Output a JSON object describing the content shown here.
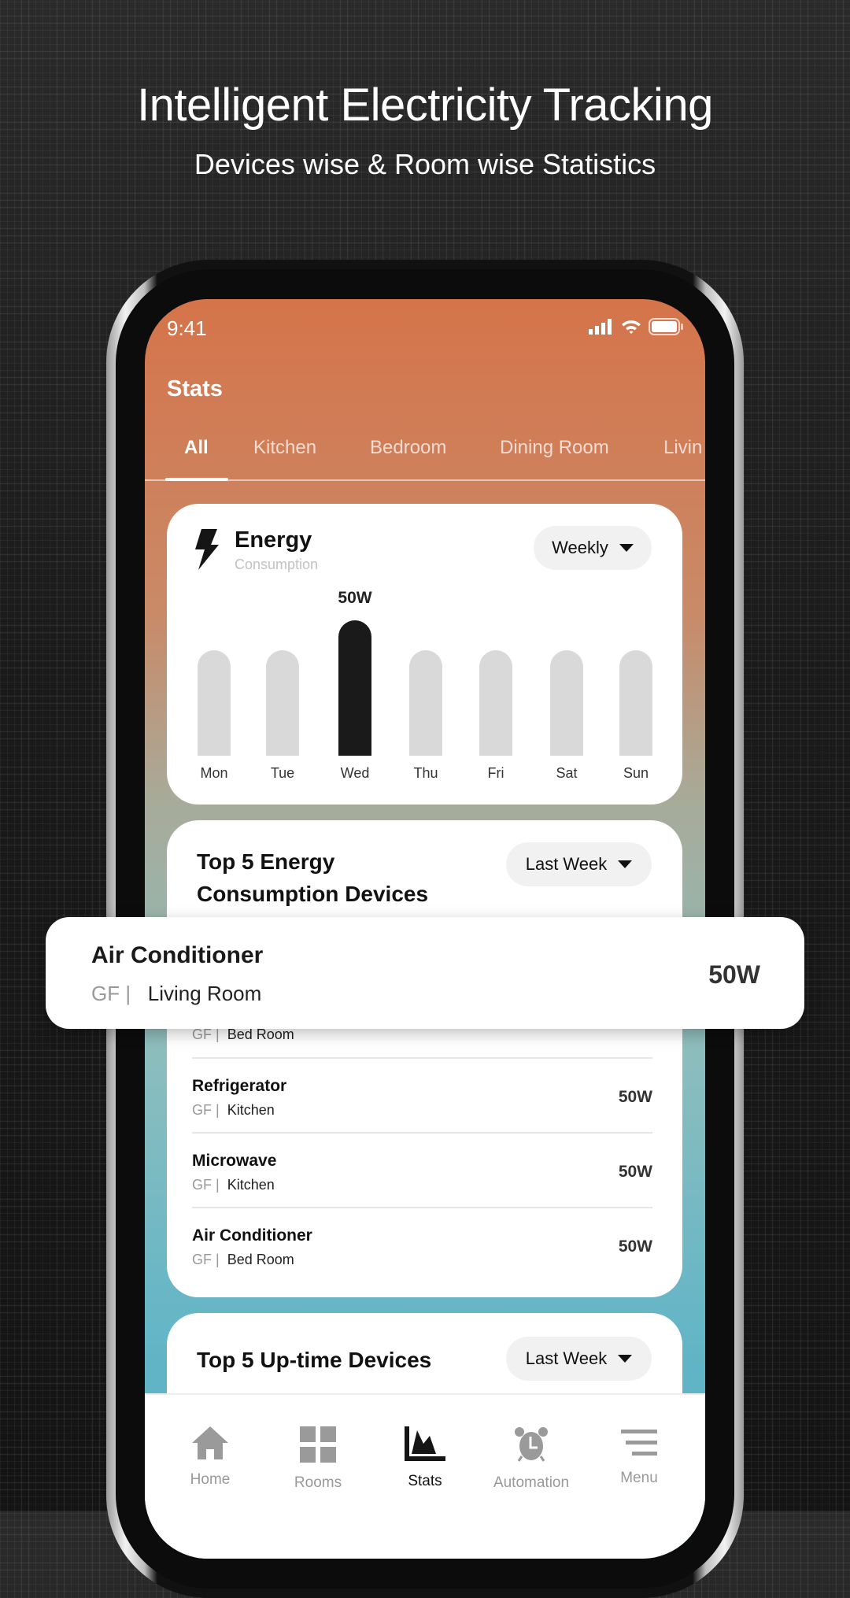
{
  "hero": {
    "title": "Intelligent Electricity Tracking",
    "subtitle": "Devices wise & Room wise Statistics"
  },
  "status_bar": {
    "time": "9:41",
    "icons": [
      "signal-icon",
      "wifi-icon",
      "battery-icon"
    ]
  },
  "header": {
    "title": "Stats"
  },
  "tabs": [
    {
      "label": "All",
      "active": true
    },
    {
      "label": "Kitchen"
    },
    {
      "label": "Bedroom"
    },
    {
      "label": "Dining Room"
    },
    {
      "label": "Livin"
    }
  ],
  "energy_card": {
    "title": "Energy",
    "subtitle": "Consumption",
    "period": "Weekly",
    "icon": "lightning-bolt-icon"
  },
  "chart_data": {
    "type": "bar",
    "categories": [
      "Mon",
      "Tue",
      "Wed",
      "Thu",
      "Fri",
      "Sat",
      "Sun"
    ],
    "values": [
      39,
      39,
      50,
      39,
      39,
      39,
      39
    ],
    "highlight": "Wed",
    "data_label": "50W",
    "highlight_color": "#1a1a1a",
    "bar_color": "#d9d9d9"
  },
  "top_energy": {
    "title_line1": "Top 5 Energy",
    "title_line2": "Consumption Devices",
    "period": "Last Week",
    "featured": {
      "name": "Air Conditioner",
      "floor": "GF",
      "sep": "|",
      "room": "Living Room",
      "value": "50W"
    },
    "rows": [
      {
        "name": "",
        "floor": "GF",
        "sep": "|",
        "room": "Bed Room",
        "value": ""
      },
      {
        "name": "Refrigerator",
        "floor": "GF",
        "sep": "|",
        "room": "Kitchen",
        "value": "50W"
      },
      {
        "name": "Microwave",
        "floor": "GF",
        "sep": "|",
        "room": "Kitchen",
        "value": "50W"
      },
      {
        "name": "Air Conditioner",
        "floor": "GF",
        "sep": "|",
        "room": "Bed Room",
        "value": "50W"
      }
    ]
  },
  "top_uptime": {
    "title": "Top 5 Up-time Devices",
    "period": "Last Week"
  },
  "nav": [
    {
      "label": "Home",
      "icon": "home-icon"
    },
    {
      "label": "Rooms",
      "icon": "grid-icon"
    },
    {
      "label": "Stats",
      "icon": "area-chart-icon",
      "active": true
    },
    {
      "label": "Automation",
      "icon": "alarm-clock-icon"
    },
    {
      "label": "Menu",
      "icon": "menu-icon"
    }
  ]
}
